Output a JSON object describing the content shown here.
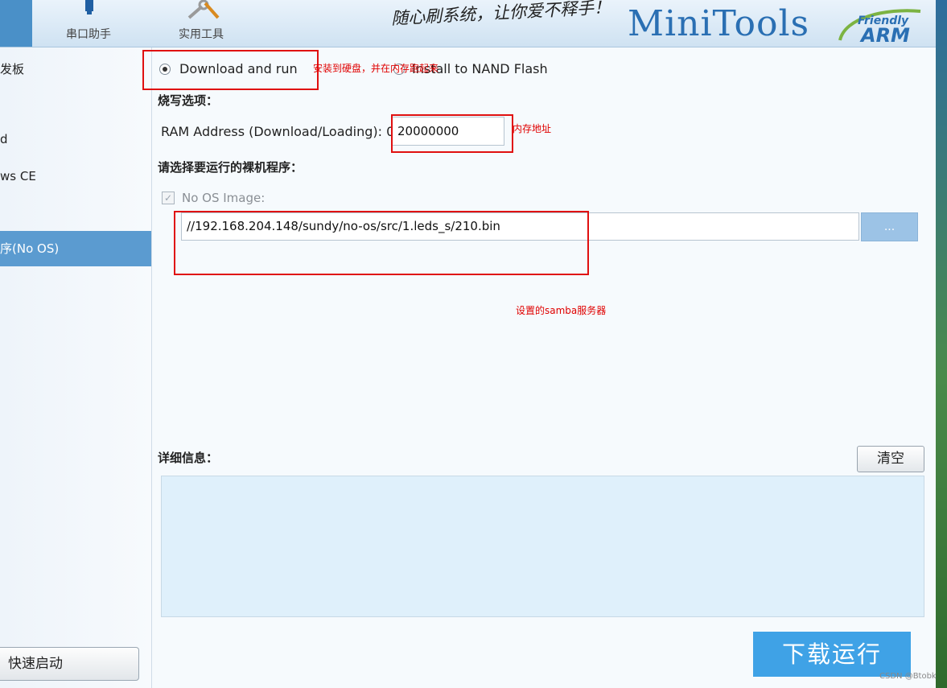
{
  "toolbar": {
    "serial_label": "串口助手",
    "tools_label": "实用工具",
    "slogan": "随心刷系统，让你爱不释手！",
    "brand": "MiniTools",
    "logo_top": "Friendly",
    "logo_bottom": "ARM"
  },
  "sidebar": {
    "items": [
      "发板",
      "d",
      "ws CE",
      "序(No OS)"
    ],
    "quick_start_label": "快速启动"
  },
  "main": {
    "radio_download_run": "Download and run",
    "radio_install_nand": "Install to NAND Flash",
    "burn_options_heading": "烧写选项：",
    "ram_address_label": "RAM Address (Download/Loading): 0x",
    "ram_address_value": "20000000",
    "select_program_heading": "请选择要运行的裸机程序：",
    "no_os_image_label": "No OS Image:",
    "image_path_value": "//192.168.204.148/sundy/no-os/src/1.leds_s/210.bin",
    "browse_label": "...",
    "details_heading": "详细信息：",
    "clear_label": "清空",
    "run_label": "下载运行"
  },
  "annotations": {
    "install_note": "安装到硬盘，并在内存跑起来",
    "memory_address_note": "内存地址",
    "samba_note": "设置的samba服务器"
  },
  "watermark": "CSDN @Btobk",
  "colors": {
    "annotation_red": "#e01010",
    "sidebar_selected": "#5b9bd0",
    "run_button": "#3fa2e6",
    "brand_blue": "#2a6fb3"
  }
}
